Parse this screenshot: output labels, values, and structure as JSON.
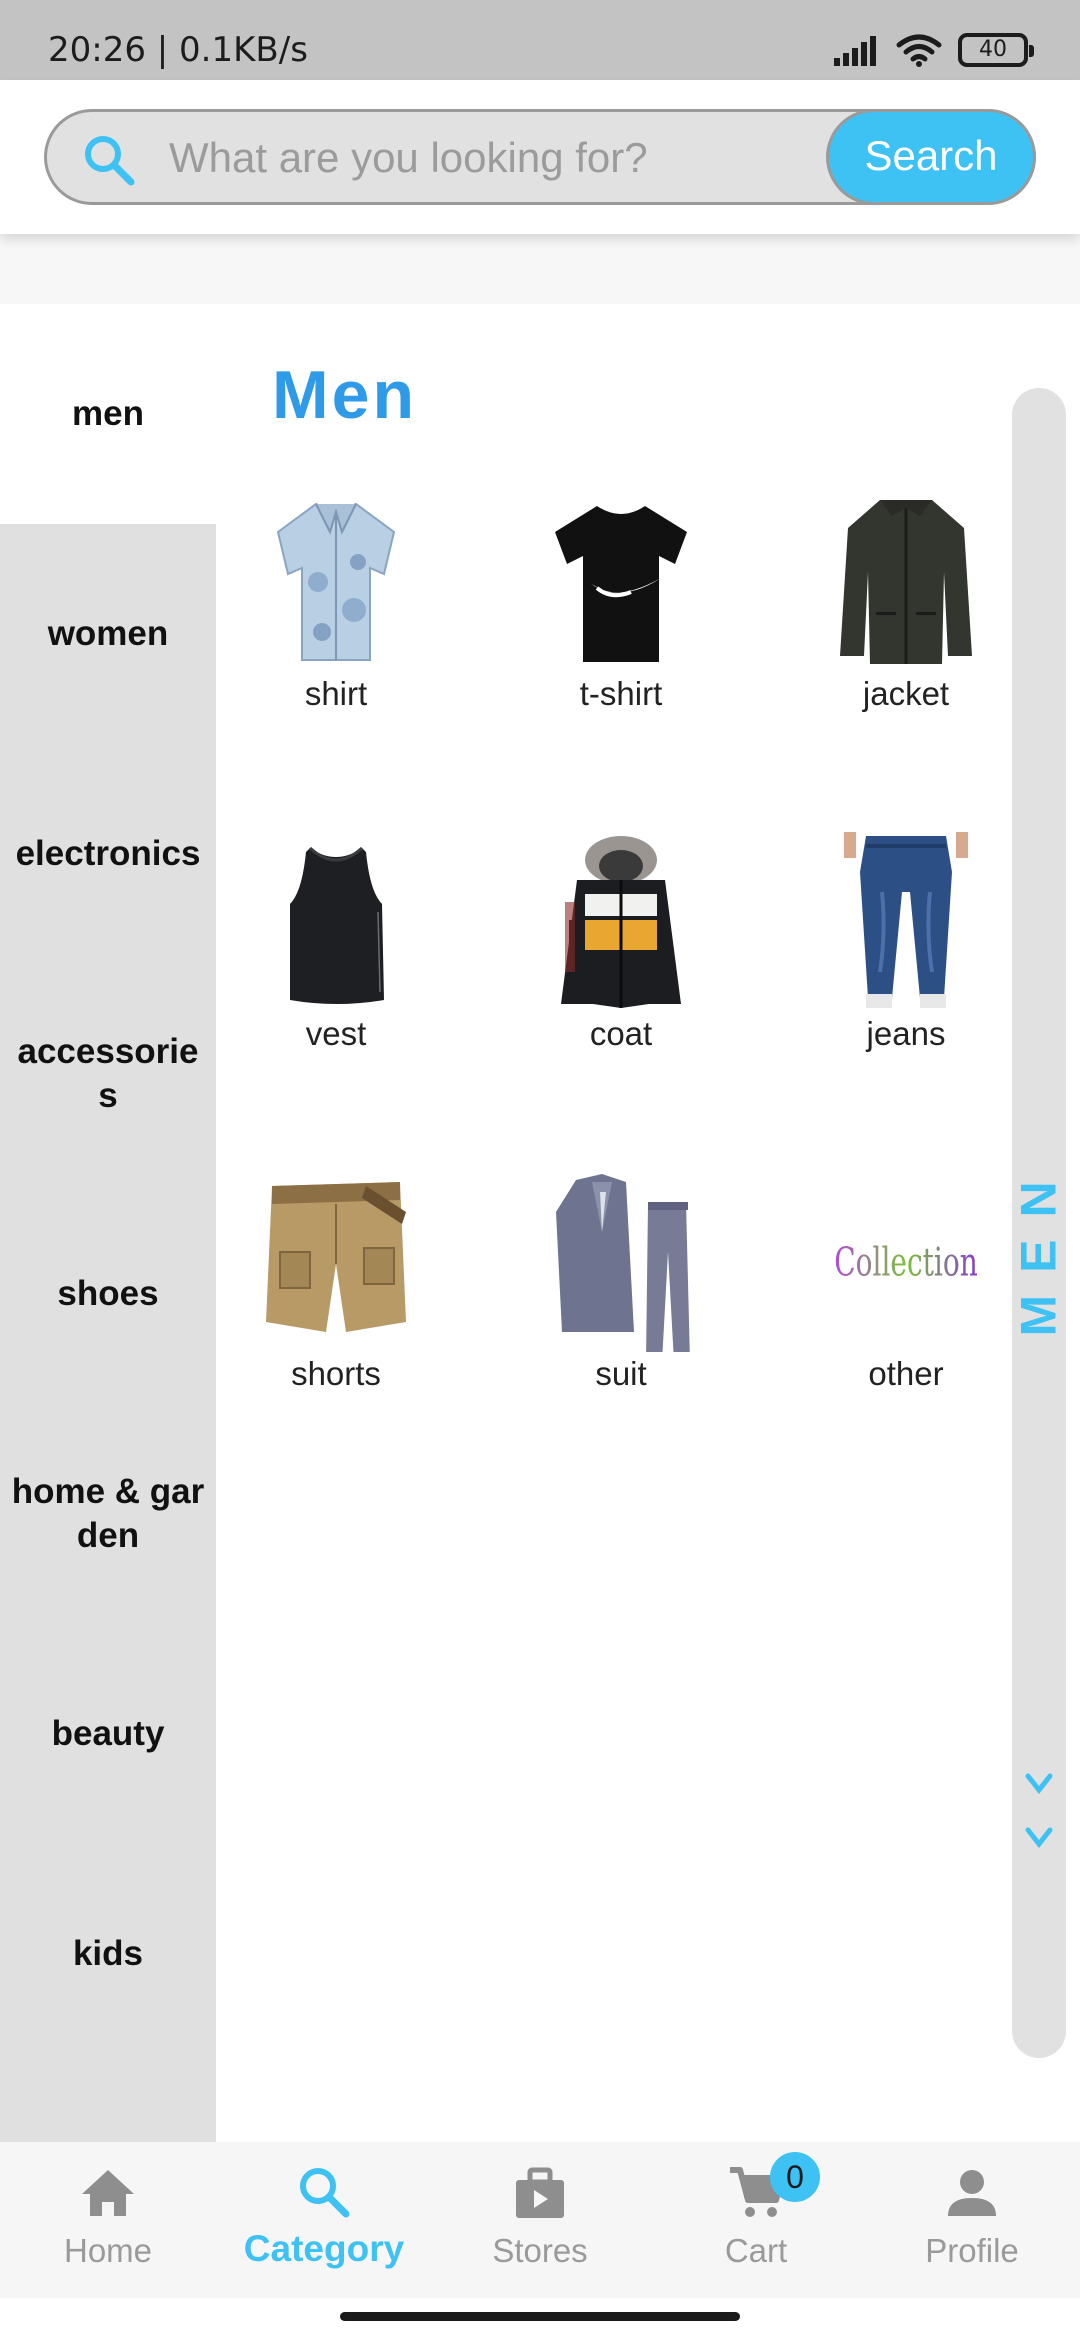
{
  "status_bar": {
    "time_speed": "20:26 | 0.1KB/s",
    "battery": "40"
  },
  "search": {
    "placeholder": "What are you looking for?",
    "button_label": "Search"
  },
  "sidebar": {
    "items": [
      {
        "label": "men",
        "active": true
      },
      {
        "label": "women"
      },
      {
        "label": "electronics"
      },
      {
        "label": "accessories"
      },
      {
        "label": "shoes"
      },
      {
        "label": "home & garden"
      },
      {
        "label": "beauty"
      },
      {
        "label": "kids"
      }
    ]
  },
  "main": {
    "title": "Men",
    "items": [
      {
        "label": "shirt",
        "icon": "shirt-image"
      },
      {
        "label": "t-shirt",
        "icon": "tshirt-image"
      },
      {
        "label": "jacket",
        "icon": "jacket-image"
      },
      {
        "label": "vest",
        "icon": "vest-image"
      },
      {
        "label": "coat",
        "icon": "coat-image"
      },
      {
        "label": "jeans",
        "icon": "jeans-image"
      },
      {
        "label": "shorts",
        "icon": "shorts-image"
      },
      {
        "label": "suit",
        "icon": "suit-image"
      },
      {
        "label": "other",
        "icon": "collection-image",
        "image_text": "Collection"
      }
    ]
  },
  "rail": {
    "label": "MEN"
  },
  "bottom_nav": {
    "items": [
      {
        "label": "Home",
        "icon": "home-icon"
      },
      {
        "label": "Category",
        "icon": "search-icon",
        "active": true
      },
      {
        "label": "Stores",
        "icon": "store-bag-icon"
      },
      {
        "label": "Cart",
        "icon": "cart-icon"
      },
      {
        "label": "Profile",
        "icon": "profile-icon"
      }
    ],
    "cart_count": "0"
  },
  "colors": {
    "accent": "#3ec1f3",
    "title_blue": "#2f9ae8",
    "sidebar_bg": "#e0e0e0"
  }
}
